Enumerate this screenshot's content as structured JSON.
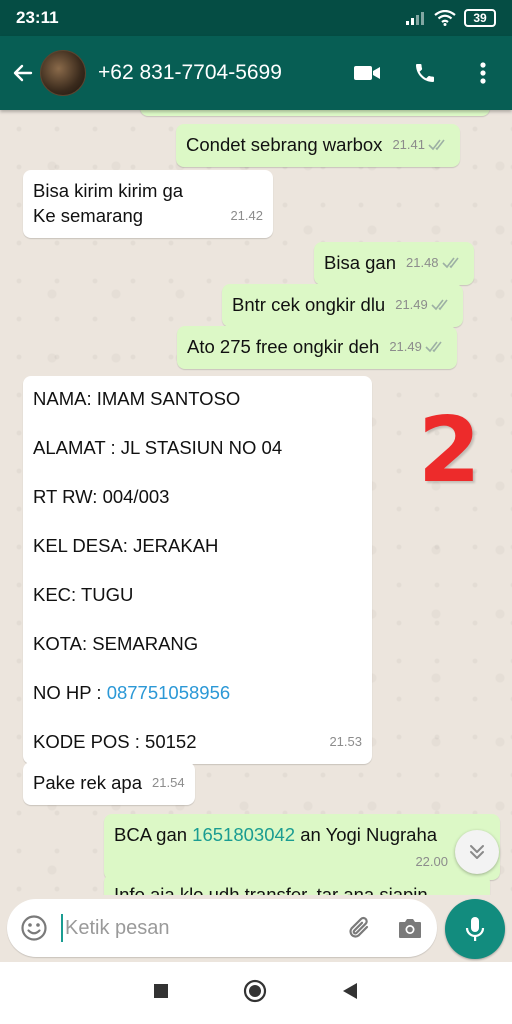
{
  "status_bar": {
    "time": "23:11",
    "battery": "39"
  },
  "header": {
    "contact_name": "+62 831-7704-5699"
  },
  "messages": [
    {
      "dir": "out",
      "text": "Condet sebrang warbox",
      "time": "21.41"
    },
    {
      "dir": "in",
      "lines": [
        "Bisa kirim kirim ga",
        "Ke semarang"
      ],
      "time": "21.42"
    },
    {
      "dir": "out",
      "text": "Bisa gan",
      "time": "21.48"
    },
    {
      "dir": "out",
      "text": "Bntr cek ongkir dlu",
      "time": "21.49"
    },
    {
      "dir": "out",
      "text": "Ato 275 free ongkir deh",
      "time": "21.49"
    },
    {
      "dir": "in",
      "address": {
        "nama": "NAMA: IMAM SANTOSO",
        "alamat": "ALAMAT : JL STASIUN NO 04",
        "rtrw": "RT RW: 004/003",
        "kel": "KEL DESA: JERAKAH",
        "kec": "KEC: TUGU",
        "kota": "KOTA: SEMARANG",
        "nohp_label": "NO HP :",
        "nohp": "087751058956",
        "kodepos": "KODE POS : 50152"
      },
      "time": "21.53"
    },
    {
      "dir": "in",
      "text": "Pake rek apa",
      "time": "21.54"
    },
    {
      "dir": "out",
      "prefix": "BCA gan",
      "account": "1651803042",
      "suffix": "an Yogi Nugraha",
      "time": "22.00"
    },
    {
      "dir": "out",
      "text": "Info aja klo udh transfer, tar ana siapin"
    }
  ],
  "annotation": "2",
  "input": {
    "placeholder": "Ketik pesan"
  }
}
